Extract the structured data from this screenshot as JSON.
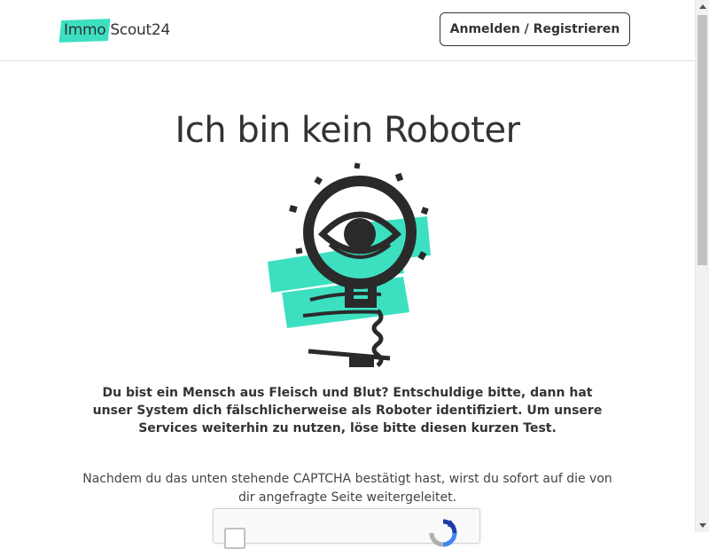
{
  "header": {
    "logo": {
      "part1": "Immo",
      "part2": "Scout24"
    },
    "login_button": "Anmelden / Registrieren"
  },
  "main": {
    "title": "Ich bin kein Roboter",
    "lead": "Du bist ein Mensch aus Fleisch und Blut? Entschuldige bitte, dann hat unser System dich fälschlicherweise als Roboter identifiziert. Um unsere Services weiterhin zu nutzen, löse bitte diesen kurzen Test.",
    "info": "Nachdem du das unten stehende CAPTCHA bestätigt hast, wirst du sofort auf die von dir angefragte Seite weitergeleitet."
  },
  "colors": {
    "accent": "#3ce0c0",
    "text": "#333333",
    "border": "#e0e0e0"
  },
  "icons": {
    "illustration": "lamp-eye-illustration",
    "captcha": "recaptcha-icon"
  }
}
